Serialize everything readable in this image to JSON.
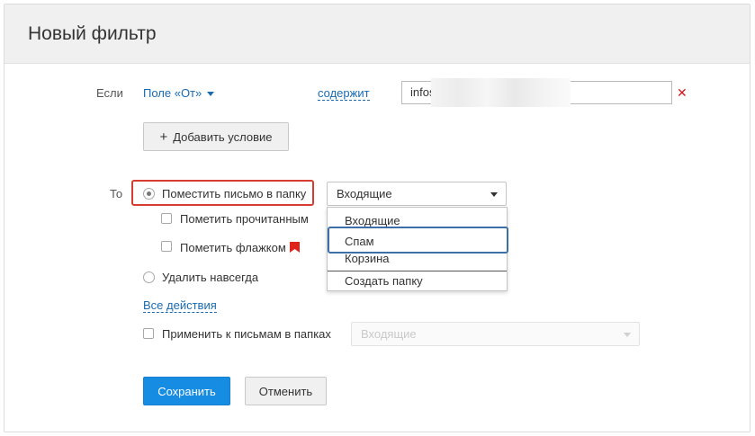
{
  "header": {
    "title": "Новый фильтр"
  },
  "condition": {
    "if_label": "Если",
    "field_label": "Поле «От»",
    "operator_label": "содержит",
    "value": "infos",
    "add_condition_label": "Добавить условие"
  },
  "actions": {
    "then_label": "То",
    "move_to_folder_label": "Поместить письмо в папку",
    "folder_selected": "Входящие",
    "mark_read_label": "Пометить прочитанным",
    "mark_flag_label": "Пометить флажком",
    "delete_forever_label": "Удалить навсегда",
    "all_actions_label": "Все действия"
  },
  "folder_dropdown": {
    "options": [
      "Входящие",
      "Спам",
      "Корзина"
    ],
    "create_folder_label": "Создать папку",
    "highlighted": "Спам"
  },
  "apply_to_folders": {
    "label": "Применить к письмам в папках",
    "selected": "Входящие"
  },
  "footer": {
    "save_label": "Сохранить",
    "cancel_label": "Отменить"
  },
  "colors": {
    "primary_button": "#168de2",
    "link": "#1a6bb0",
    "remove": "#d0191f",
    "highlight_red": "#d63c2f",
    "highlight_blue": "#3e6fa6",
    "flag": "#e0231a"
  }
}
